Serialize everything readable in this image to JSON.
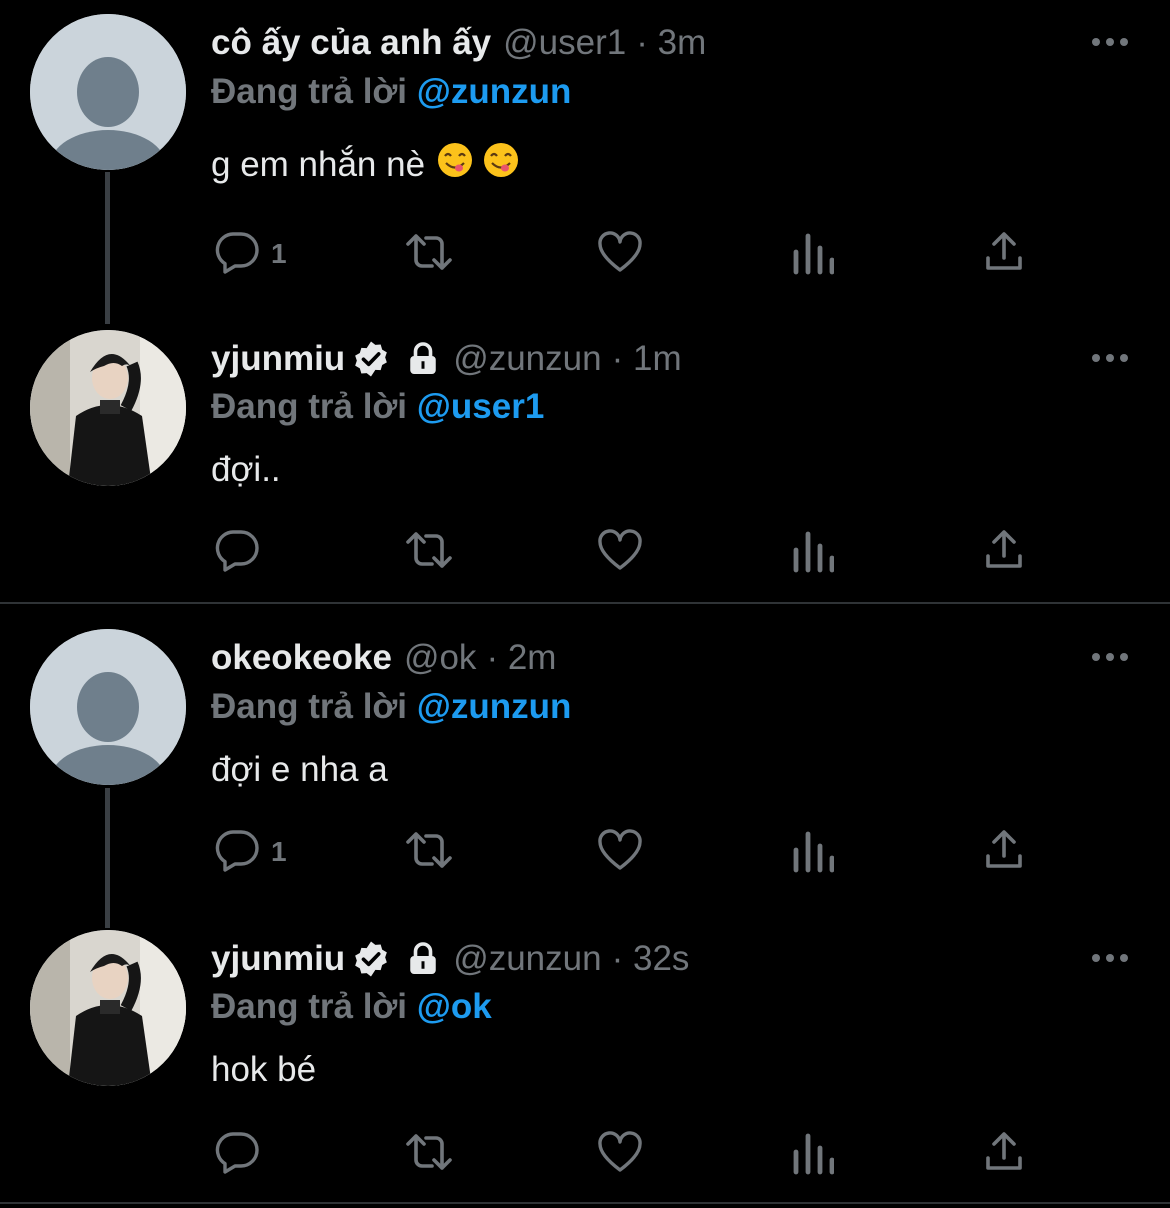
{
  "colors": {
    "background": "#000000",
    "primary_text": "#e7e9ea",
    "secondary_text": "#71767b",
    "mention": "#1d9bf0",
    "thread_line": "#3a3f44",
    "divider": "#2f3336"
  },
  "tweets": [
    {
      "display_name": "cô ấy của anh ấy",
      "handle": "@user1",
      "time": "· 3m",
      "verified": false,
      "locked": false,
      "avatar": "default-avatar",
      "replying_prefix": "Đang trả lời",
      "replying_to": "@zunzun",
      "text": "g em nhắn nè",
      "emojis": [
        "yum-face-emoji",
        "yum-face-emoji"
      ],
      "reply_count": "1"
    },
    {
      "display_name": "yjunmiu",
      "handle": "@zunzun",
      "time": "· 1m",
      "verified": true,
      "locked": true,
      "avatar": "photo-avatar",
      "replying_prefix": "Đang trả lời",
      "replying_to": "@user1",
      "text": "đợi..",
      "reply_count": ""
    },
    {
      "display_name": "okeokeoke",
      "handle": "@ok",
      "time": "· 2m",
      "verified": false,
      "locked": false,
      "avatar": "default-avatar",
      "replying_prefix": "Đang trả lời",
      "replying_to": "@zunzun",
      "text": "đợi e nha a",
      "reply_count": "1"
    },
    {
      "display_name": "yjunmiu",
      "handle": "@zunzun",
      "time": "· 32s",
      "verified": true,
      "locked": true,
      "avatar": "photo-avatar",
      "replying_prefix": "Đang trả lời",
      "replying_to": "@ok",
      "text": "hok bé",
      "reply_count": ""
    }
  ],
  "action_icons": [
    "reply-icon",
    "retweet-icon",
    "like-icon",
    "views-icon",
    "share-icon"
  ],
  "more_icon": "more-icon"
}
